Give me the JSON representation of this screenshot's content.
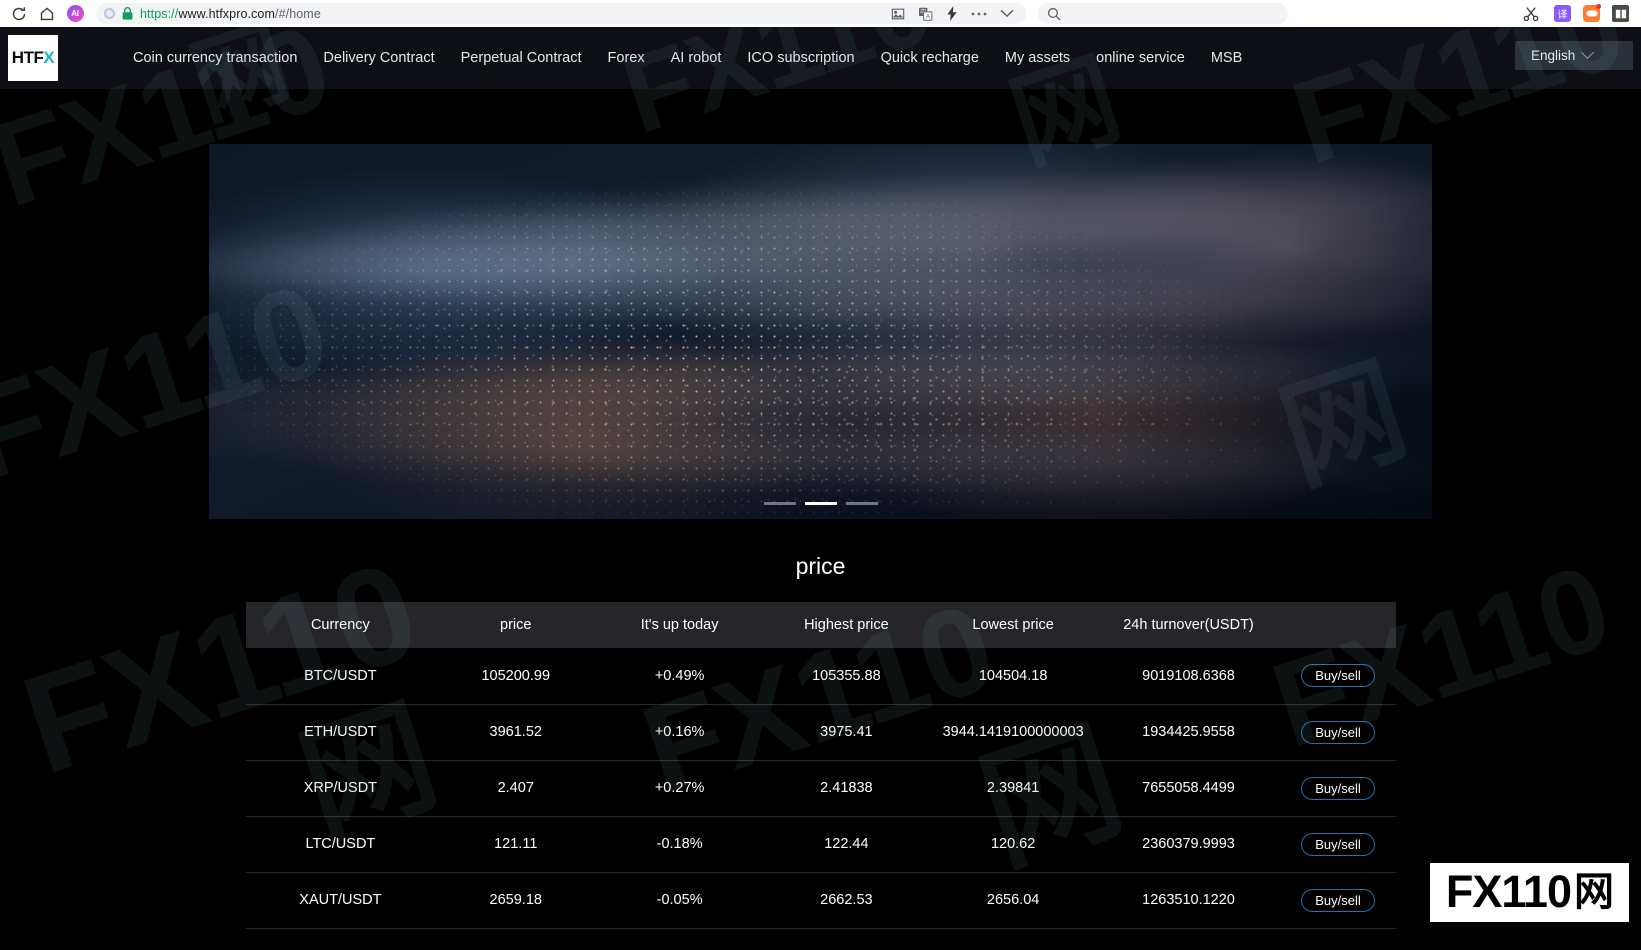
{
  "browser": {
    "url_scheme": "https://",
    "url_host": "www.htfxpro.com",
    "url_path": "/#/home",
    "icons": {
      "reload": "reload-icon",
      "home": "home-icon",
      "ai": "AI",
      "tracking_protection": "shield-dot-icon",
      "lock": "lock-icon",
      "image": "image-icon",
      "translate_page": "translate-icon",
      "lightning": "lightning-icon",
      "more": "more-dots-icon",
      "chevron": "chevron-down-icon",
      "search": "search-icon",
      "scissors": "scissors-icon",
      "ext_translate": "译",
      "ext_game": "game-controller-icon",
      "ext_book": "book-icon"
    }
  },
  "site": {
    "logo_text": "HTF",
    "logo_accent": "X",
    "nav": [
      {
        "label": "Coin currency transaction"
      },
      {
        "label": "Delivery Contract"
      },
      {
        "label": "Perpetual Contract"
      },
      {
        "label": "Forex"
      },
      {
        "label": "AI robot"
      },
      {
        "label": "ICO subscription"
      },
      {
        "label": "Quick recharge"
      },
      {
        "label": "My assets"
      },
      {
        "label": "online service"
      },
      {
        "label": "MSB"
      }
    ],
    "language": "English"
  },
  "banner": {
    "slides": 3,
    "active_index": 1
  },
  "price_section": {
    "title": "price",
    "columns": [
      "Currency",
      "price",
      "It's up today",
      "Highest price",
      "Lowest price",
      "24h turnover(USDT)"
    ],
    "action_label": "Buy/sell",
    "rows": [
      {
        "currency": "BTC/USDT",
        "price": "105200.99",
        "change": "+0.49%",
        "direction": "up",
        "high": "105355.88",
        "low": "104504.18",
        "turnover": "9019108.6368"
      },
      {
        "currency": "ETH/USDT",
        "price": "3961.52",
        "change": "+0.16%",
        "direction": "up",
        "high": "3975.41",
        "low": "3944.1419100000003",
        "turnover": "1934425.9558"
      },
      {
        "currency": "XRP/USDT",
        "price": "2.407",
        "change": "+0.27%",
        "direction": "up",
        "high": "2.41838",
        "low": "2.39841",
        "turnover": "7655058.4499"
      },
      {
        "currency": "LTC/USDT",
        "price": "121.11",
        "change": "-0.18%",
        "direction": "down",
        "high": "122.44",
        "low": "120.62",
        "turnover": "2360379.9993"
      },
      {
        "currency": "XAUT/USDT",
        "price": "2659.18",
        "change": "-0.05%",
        "direction": "down",
        "high": "2662.53",
        "low": "2656.04",
        "turnover": "1263510.1220"
      }
    ]
  },
  "watermark": {
    "text": "FX110",
    "cn": "网",
    "badge_text": "FX110",
    "badge_cn": "网"
  },
  "colors": {
    "up": "#0f9d74",
    "down": "#d64545",
    "accent": "#19b5c9",
    "header_bg": "#0d0f14",
    "table_header_bg": "#26262a",
    "buy_border": "#2c6ea8"
  }
}
